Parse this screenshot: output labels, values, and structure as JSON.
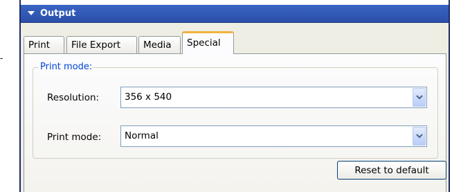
{
  "panel": {
    "title": "Output"
  },
  "tabs": [
    {
      "label": "Print",
      "active": false
    },
    {
      "label": "File Export",
      "active": false
    },
    {
      "label": "Media",
      "active": false
    },
    {
      "label": "Special",
      "active": true
    }
  ],
  "group": {
    "legend": "Print mode:"
  },
  "fields": {
    "resolution": {
      "label": "Resolution:",
      "value": "356 x 540"
    },
    "print_mode": {
      "label": "Print mode:",
      "value": "Normal"
    }
  },
  "buttons": {
    "reset_label": "Reset to default"
  },
  "colors": {
    "header": "#2a4fa8",
    "active_tab_accent": "#f1b33c",
    "legend": "#0046d5"
  }
}
